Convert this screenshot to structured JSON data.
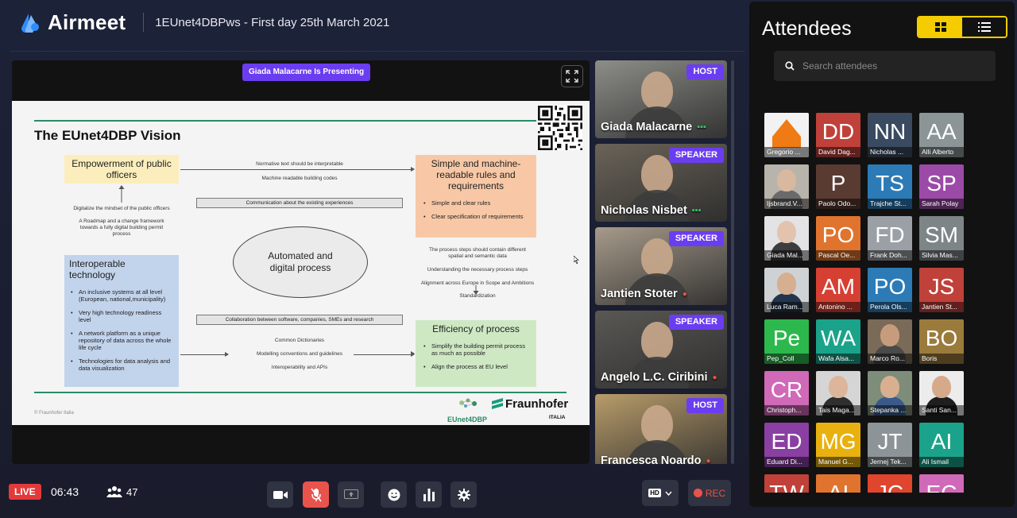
{
  "header": {
    "logo_text": "Airmeet",
    "event_title": "1EUnet4DBPws - First day 25th March 2021"
  },
  "stage": {
    "presenting_label": "Giada Malacarne Is Presenting"
  },
  "slide": {
    "title": "The EUnet4DBP Vision",
    "box_empowerment": "Empowerment of public officers",
    "box_rules_title": "Simple and machine-readable rules and requirements",
    "box_rules_items": [
      "Simple and clear rules",
      "Clear specification of requirements"
    ],
    "box_interop_title": "Interoperable technology",
    "box_interop_items": [
      "An inclusive systems at all level (European, national,municipality)",
      "Very high technology readiness level",
      "A network platform as a unique repository of data across the whole life cycle",
      "Technologies for data analysis and data visualization"
    ],
    "box_efficiency_title": "Efficiency of process",
    "box_efficiency_items": [
      "Simplify the building permit process as much as possible",
      "Align the process at EU level"
    ],
    "center": "Automated and digital process",
    "t_normative": "Normative text should be interpretable",
    "t_machine": "Machine readable building codes",
    "t_communication": "Communication about the existing experiences",
    "t_digitalize": "Digitalize the mindset of the public officers",
    "t_roadmap": "A Roadmap and a change framework towards a fully digital building permit process",
    "t_process_steps": "The process steps should contain different spatial and semantic data",
    "t_understanding": "Understanding the necessary process steps",
    "t_alignment": "Alignment across Europe in Scope and Ambitions",
    "t_standardization": "Standardization",
    "t_collaboration": "Collaboration between software, companies, SMEs and research",
    "t_dictionaries": "Common Dictionaries",
    "t_modelling": "Modelling conventions and guidelines",
    "t_interop_apis": "Interoperability and APIs",
    "copyright": "© Fraunhofer Italia",
    "logo_eunet": "EUnet4DBP",
    "logo_fraunhofer": "Fraunhofer",
    "logo_italia": "ITALIA"
  },
  "speakers": [
    {
      "name": "Giada Malacarne",
      "role": "HOST",
      "indicator": "▪▪▪",
      "bg": "#8d8e88"
    },
    {
      "name": "Nicholas Nisbet",
      "role": "SPEAKER",
      "indicator": "▪▪▪",
      "bg": "#6a6358"
    },
    {
      "name": "Jantien Stoter",
      "role": "SPEAKER",
      "indicator": "🎤",
      "bg": "#a69b8b"
    },
    {
      "name": "Angelo L.C. Ciribini",
      "role": "SPEAKER",
      "indicator": "🎤",
      "bg": "#5a5854"
    },
    {
      "name": "Francesca Noardo",
      "role": "HOST",
      "indicator": "🎤",
      "bg": "#b89c6a"
    }
  ],
  "panel": {
    "title": "Attendees",
    "search_placeholder": "Search attendees"
  },
  "attendees": [
    {
      "ini": "",
      "name": "Gregorio ...",
      "bg": "#f2f2f2",
      "photo": "house"
    },
    {
      "ini": "DD",
      "name": "David Dag...",
      "bg": "#c0413a"
    },
    {
      "ini": "NN",
      "name": "Nicholas ...",
      "bg": "#3a4a60"
    },
    {
      "ini": "AA",
      "name": "Alli Alberto",
      "bg": "#8b9596"
    },
    {
      "ini": "",
      "name": "Ijsbrand.V...",
      "bg": "#b8b3ab",
      "photo": "person",
      "skin": "#d9b8a0",
      "cloth": "#6a6a6a"
    },
    {
      "ini": "P",
      "name": "Paolo Odo...",
      "bg": "#5a3b32"
    },
    {
      "ini": "TS",
      "name": "Trajche St...",
      "bg": "#2c7bb6"
    },
    {
      "ini": "SP",
      "name": "Sarah Polay",
      "bg": "#9b4aa8"
    },
    {
      "ini": "",
      "name": "Giada Mal...",
      "bg": "#e3e3e6",
      "photo": "person",
      "skin": "#e2c3ae",
      "cloth": "#3d3d3d"
    },
    {
      "ini": "PO",
      "name": "Pascal Oe...",
      "bg": "#e0742e"
    },
    {
      "ini": "FD",
      "name": "Frank Doh...",
      "bg": "#9aa0a6"
    },
    {
      "ini": "SM",
      "name": "Silvia Mas...",
      "bg": "#7e8587"
    },
    {
      "ini": "",
      "name": "Luca Ram...",
      "bg": "#cfd2d4",
      "photo": "person",
      "skin": "#d6ae90",
      "cloth": "#23344d"
    },
    {
      "ini": "AM",
      "name": "Antonino ...",
      "bg": "#d64032"
    },
    {
      "ini": "PO",
      "name": "Perola Ols...",
      "bg": "#2c7bb6"
    },
    {
      "ini": "JS",
      "name": "Jantien St...",
      "bg": "#c0413a"
    },
    {
      "ini": "Pe",
      "name": "Pep_Coll",
      "bg": "#2db84d"
    },
    {
      "ini": "WA",
      "name": "Wafa Alsa...",
      "bg": "#1aa38a"
    },
    {
      "ini": "",
      "name": "Marco Ro...",
      "bg": "#7a6a58",
      "photo": "person",
      "skin": "#c79c7c",
      "cloth": "#4a4a4a"
    },
    {
      "ini": "BO",
      "name": "Boris",
      "bg": "#9b7b3c"
    },
    {
      "ini": "CR",
      "name": "Christoph...",
      "bg": "#d069b8"
    },
    {
      "ini": "",
      "name": "Tais Maga...",
      "bg": "#d5d5d5",
      "photo": "person",
      "skin": "#dcb59a",
      "cloth": "#2f2f2f"
    },
    {
      "ini": "",
      "name": "Stepanka ...",
      "bg": "#7e8c7a",
      "photo": "person",
      "skin": "#d8b090",
      "cloth": "#3a5a8a"
    },
    {
      "ini": "",
      "name": "Santi San...",
      "bg": "#ececec",
      "photo": "person",
      "skin": "#d7a98b",
      "cloth": "#1f1f1f"
    },
    {
      "ini": "ED",
      "name": "Eduard Di...",
      "bg": "#8a3fa3"
    },
    {
      "ini": "MG",
      "name": "Manuel G...",
      "bg": "#e8b10f"
    },
    {
      "ini": "JT",
      "name": "Jernej Tek...",
      "bg": "#8d9497"
    },
    {
      "ini": "AI",
      "name": "Ali Ismail",
      "bg": "#1aa38a"
    },
    {
      "ini": "TW",
      "name": "",
      "bg": "#c0413a"
    },
    {
      "ini": "AI",
      "name": "",
      "bg": "#e0742e"
    },
    {
      "ini": "JC",
      "name": "",
      "bg": "#e0452e"
    },
    {
      "ini": "EC",
      "name": "",
      "bg": "#d069b8"
    }
  ],
  "bottom": {
    "live": "LIVE",
    "timer": "06:43",
    "attendee_count": "47",
    "quality": "HD",
    "rec": "REC"
  },
  "colors": {
    "accent_purple": "#6b3df0",
    "accent_yellow": "#f5cc00",
    "live_red": "#e23a3a"
  }
}
